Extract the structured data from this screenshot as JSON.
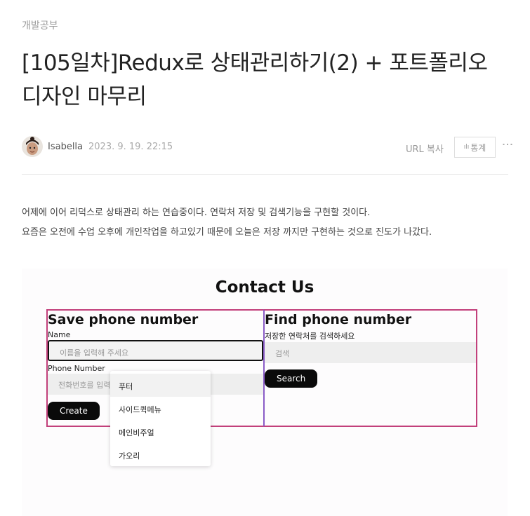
{
  "post": {
    "category": "개발공부",
    "title": "[105일차]Redux로 상태관리하기(2) + 포트폴리오 디자인 마무리",
    "author": "Isabella",
    "date": "2023. 9. 19. 22:15",
    "url_copy": "URL 복사",
    "stats_label": "통계",
    "more_glyph": "⋮",
    "paragraphs": [
      "어제에 이어 리덕스로 상태관리 하는 연습중이다. 연락처 저장 및 검색기능을 구현할 것이다.",
      "요즘은 오전에 수업 오후에 개인작업을 하고있기 때문에 오늘은 저장 까지만 구현하는 것으로 진도가 나갔다."
    ]
  },
  "screenshot": {
    "heading": "Contact Us",
    "save": {
      "title": "Save phone number",
      "name_label": "Name",
      "name_placeholder": "이름을 입력해 주세요",
      "phone_label": "Phone Number",
      "phone_placeholder": "전화번호를 입력",
      "create_label": "Create"
    },
    "find": {
      "title": "Find phone number",
      "hint": "저장한 연락처를 검색하세요",
      "search_placeholder": "검색",
      "search_label": "Search"
    },
    "autocomplete": [
      "푸터",
      "사이드퀵메뉴",
      "메인비주얼",
      "가오리"
    ]
  },
  "colors": {
    "box_border": "#c2407b",
    "divider_border": "#8a5cc7"
  }
}
